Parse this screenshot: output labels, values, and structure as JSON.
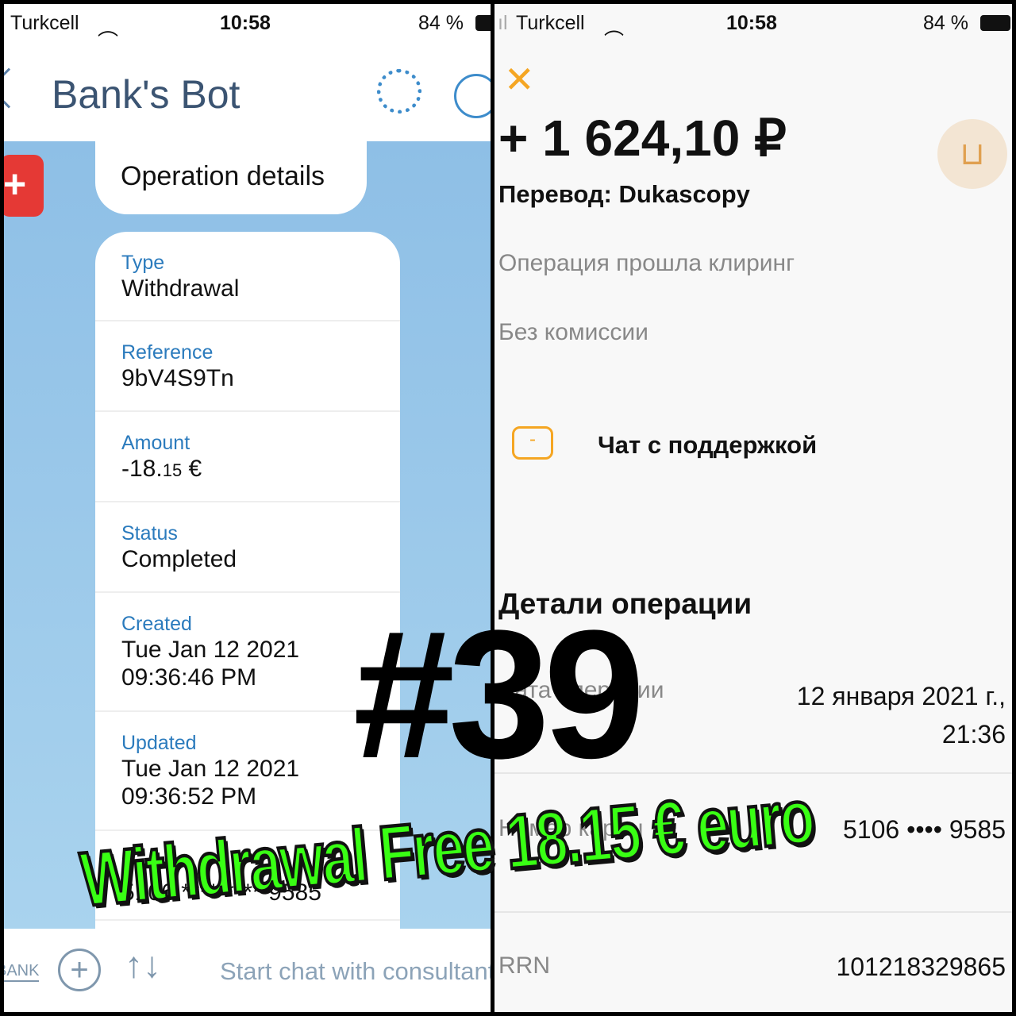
{
  "left": {
    "status": {
      "carrier": "Turkcell",
      "time": "10:58",
      "battery": "84 %"
    },
    "header": {
      "title": "Bank's Bot"
    },
    "bubble": "Operation details",
    "rows": [
      {
        "label": "Type",
        "value": "Withdrawal"
      },
      {
        "label": "Reference",
        "value": "9bV4S9Tn"
      },
      {
        "label": "Amount",
        "value_main": "-18.",
        "value_cents": "15",
        "value_currency": " €"
      },
      {
        "label": "Status",
        "value": "Completed"
      },
      {
        "label": "Created",
        "value": "Tue Jan 12 2021",
        "value2": "09:36:46 PM"
      },
      {
        "label": "Updated",
        "value": "Tue Jan 12 2021",
        "value2": "09:36:52 PM"
      },
      {
        "value": "5106 **** **** 9585"
      }
    ],
    "bottom": {
      "bank_label": "BANK",
      "placeholder": "Start chat with consultant"
    }
  },
  "right": {
    "status": {
      "carrier": "Turkcell",
      "time": "10:58",
      "battery": "84 %"
    },
    "amount": "+ 1 624,10 ₽",
    "subtitle": "Перевод: Dukascopy",
    "cleared": "Операция прошла клиринг",
    "fee": "Без комиссии",
    "support": "Чат с поддержкой",
    "details_title": "Детали операции",
    "rows": [
      {
        "label": "Дата операции",
        "value": "12 января 2021 г.,",
        "value2": "21:36"
      },
      {
        "label": "Номер карты",
        "value": "5106 •••• 9585"
      },
      {
        "label": "RRN",
        "value": "101218329865"
      }
    ],
    "accent": "#f5a623"
  },
  "overlay": {
    "number": "#39",
    "caption": "Withdrawal Free 18.15 € euro",
    "caption_color": "#39ff14"
  }
}
